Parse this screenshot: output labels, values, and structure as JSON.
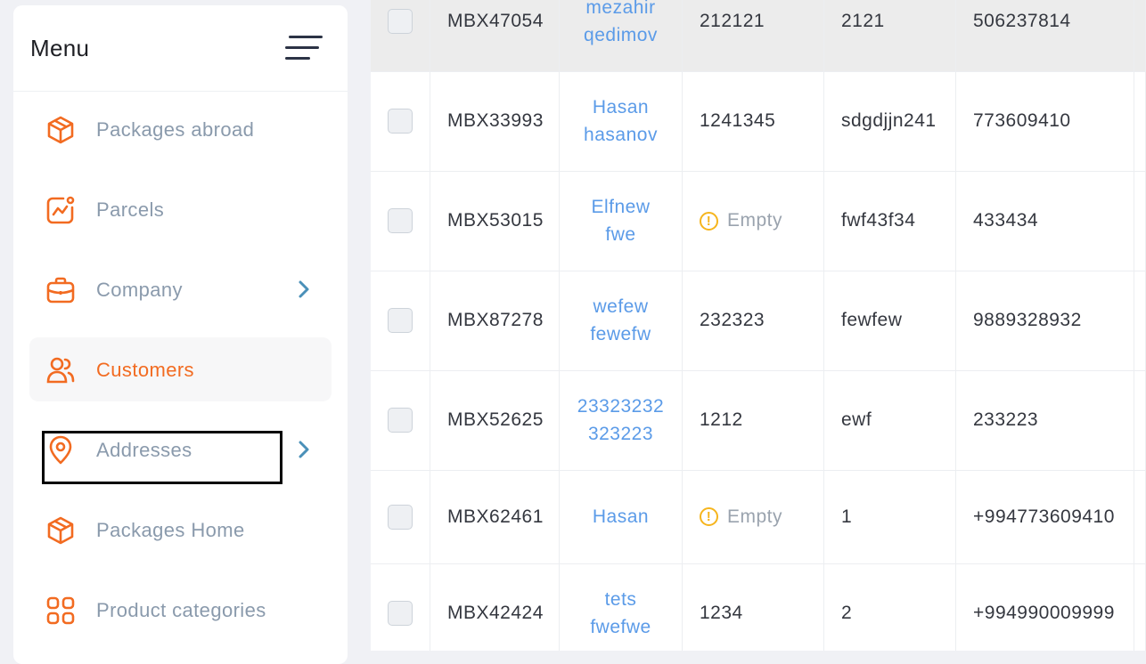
{
  "menu": {
    "title": "Menu",
    "items": [
      {
        "label": "Packages abroad",
        "icon": "box-icon",
        "has_chevron": false,
        "active": false
      },
      {
        "label": "Parcels",
        "icon": "chart-icon",
        "has_chevron": false,
        "active": false
      },
      {
        "label": "Company",
        "icon": "briefcase-icon",
        "has_chevron": true,
        "active": false
      },
      {
        "label": "Customers",
        "icon": "users-icon",
        "has_chevron": false,
        "active": true
      },
      {
        "label": "Addresses",
        "icon": "location-pin-icon",
        "has_chevron": true,
        "active": false
      },
      {
        "label": "Packages Home",
        "icon": "box-icon",
        "has_chevron": false,
        "active": false
      },
      {
        "label": "Product categories",
        "icon": "grid-icon",
        "has_chevron": false,
        "active": false
      }
    ]
  },
  "colors": {
    "accent": "#f26b21",
    "link": "#5b9be8",
    "chevron": "#4a90b8",
    "warning": "#f6b51d"
  },
  "table": {
    "empty_label": "Empty",
    "rows": [
      {
        "code": "MBX47054",
        "name_line1": "mezahir",
        "name_line2": "qedimov",
        "col_a": "212121",
        "col_b": "2121",
        "col_c": "506237814",
        "empty": false
      },
      {
        "code": "MBX33993",
        "name_line1": "Hasan",
        "name_line2": "hasanov",
        "col_a": "1241345",
        "col_b": "sdgdjjn241",
        "col_c": "773609410",
        "empty": false
      },
      {
        "code": "MBX53015",
        "name_line1": "Elfnew",
        "name_line2": "fwe",
        "col_a": "",
        "col_b": "fwf43f34",
        "col_c": "433434",
        "empty": true
      },
      {
        "code": "MBX87278",
        "name_line1": "wefew",
        "name_line2": "fewefw",
        "col_a": "232323",
        "col_b": "fewfew",
        "col_c": "9889328932",
        "empty": false
      },
      {
        "code": "MBX52625",
        "name_line1": "23323232",
        "name_line2": "323223",
        "col_a": "1212",
        "col_b": "ewf",
        "col_c": "233223",
        "empty": false
      },
      {
        "code": "MBX62461",
        "name_line1": "Hasan",
        "name_line2": "",
        "col_a": "",
        "col_b": "1",
        "col_c": "+994773609410",
        "empty": true
      },
      {
        "code": "MBX42424",
        "name_line1": "tets",
        "name_line2": "fwefwe",
        "col_a": "1234",
        "col_b": "2",
        "col_c": "+994990009999",
        "empty": false
      }
    ]
  }
}
